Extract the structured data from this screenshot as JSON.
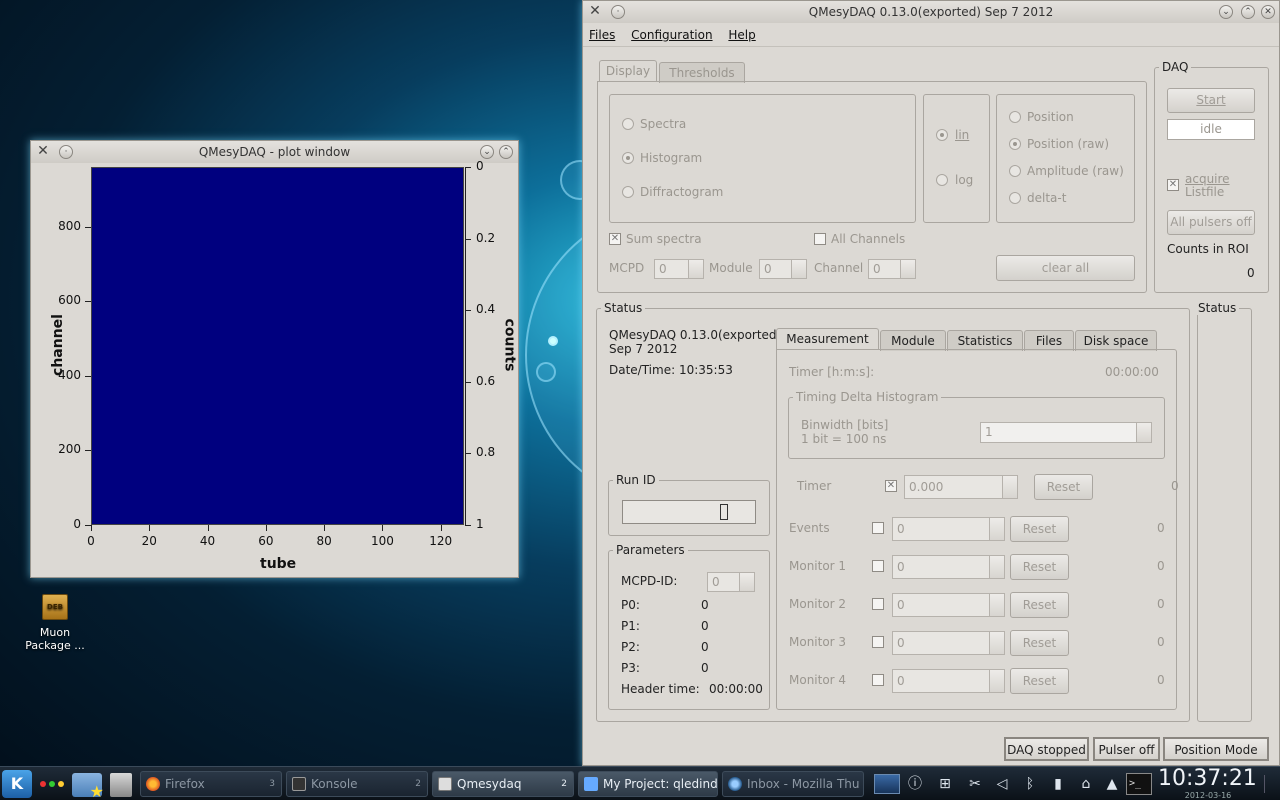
{
  "desktop": {
    "icon_label_line1": "Muon",
    "icon_label_line2": "Package ...",
    "icon_badge": "DEB"
  },
  "plot_window": {
    "title": "QMesyDAQ - plot window",
    "x_label": "tube",
    "y_label": "channel",
    "z_label": "counts",
    "x_ticks": [
      "0",
      "20",
      "40",
      "60",
      "80",
      "100",
      "120"
    ],
    "y_ticks": [
      "0",
      "200",
      "400",
      "600",
      "800"
    ],
    "z_ticks": [
      "0",
      "0.2",
      "0.4",
      "0.6",
      "0.8",
      "1"
    ]
  },
  "chart_data": {
    "type": "heatmap",
    "xlabel": "tube",
    "ylabel": "channel",
    "zlabel": "counts",
    "xlim": [
      0,
      128
    ],
    "ylim": [
      0,
      960
    ],
    "zlim": [
      0,
      1
    ],
    "values": "all zero",
    "fill_color": "#00007f"
  },
  "main_window": {
    "title": "QMesyDAQ 0.13.0(exported) Sep  7 2012",
    "menu": [
      "Files",
      "Configuration",
      "Help"
    ],
    "display_tabs": [
      "Display",
      "Thresholds"
    ],
    "display_radios": [
      "Spectra",
      "Histogram",
      "Diffractogram"
    ],
    "scale_radios": [
      "lin",
      "log"
    ],
    "position_radios": [
      "Position",
      "Position (raw)",
      "Amplitude (raw)",
      "delta-t"
    ],
    "sum_spectra": "Sum spectra",
    "all_channels": "All Channels",
    "mcpd_label": "MCPD",
    "module_label": "Module",
    "channel_label": "Channel",
    "mcpd_value": "0",
    "module_value": "0",
    "channel_value": "0",
    "clear_all": "clear all",
    "daq": {
      "title": "DAQ",
      "start": "Start",
      "state": "idle",
      "acquire_line1": "acquire",
      "acquire_line2": "Listfile",
      "all_pulsers_off": "All pulsers off",
      "counts_in_roi_label": "Counts in ROI",
      "counts_in_roi_value": "0"
    },
    "status": {
      "title": "Status",
      "version_line1": "QMesyDAQ 0.13.0(exported)",
      "version_line2": "Sep  7 2012",
      "datetime": "Date/Time: 10:35:53",
      "run_id_title": "Run ID",
      "run_id_value": "0",
      "params_title": "Parameters",
      "mcpd_id_label": "MCPD-ID:",
      "mcpd_id_value": "0",
      "params": [
        {
          "label": "P0:",
          "value": "0"
        },
        {
          "label": "P1:",
          "value": "0"
        },
        {
          "label": "P2:",
          "value": "0"
        },
        {
          "label": "P3:",
          "value": "0"
        }
      ],
      "header_time_label": "Header time:",
      "header_time_value": "00:00:00"
    },
    "status_right_title": "Status",
    "measure_tabs": [
      "Measurement",
      "Module",
      "Statistics",
      "Files",
      "Disk space"
    ],
    "measurement": {
      "timer_hms_label": "Timer [h:m:s]:",
      "timer_hms_value": "00:00:00",
      "tdh_title": "Timing Delta Histogram",
      "binwidth_label": "Binwidth [bits]",
      "binwidth_note": "1 bit = 100 ns",
      "binwidth_value": "1",
      "timer_label": "Timer",
      "timer_value": "0.000",
      "timer_count": "0",
      "reset_label": "Reset",
      "counters": [
        {
          "label": "Events",
          "value": "0",
          "count": "0"
        },
        {
          "label": "Monitor 1",
          "value": "0",
          "count": "0"
        },
        {
          "label": "Monitor 2",
          "value": "0",
          "count": "0"
        },
        {
          "label": "Monitor 3",
          "value": "0",
          "count": "0"
        },
        {
          "label": "Monitor 4",
          "value": "0",
          "count": "0"
        }
      ]
    },
    "statusbar": [
      "DAQ stopped",
      "Pulser off",
      "Position Mode"
    ]
  },
  "taskbar": {
    "tasks": [
      {
        "label": "Firefox",
        "count": "3"
      },
      {
        "label": "Konsole",
        "count": "2"
      },
      {
        "label": "Qmesydaq",
        "count": "2"
      },
      {
        "label": "My Project: qledind"
      },
      {
        "label": "Inbox - Mozilla Thu"
      }
    ],
    "clock_time": "10:37:21",
    "clock_date": "2012-03-16"
  }
}
